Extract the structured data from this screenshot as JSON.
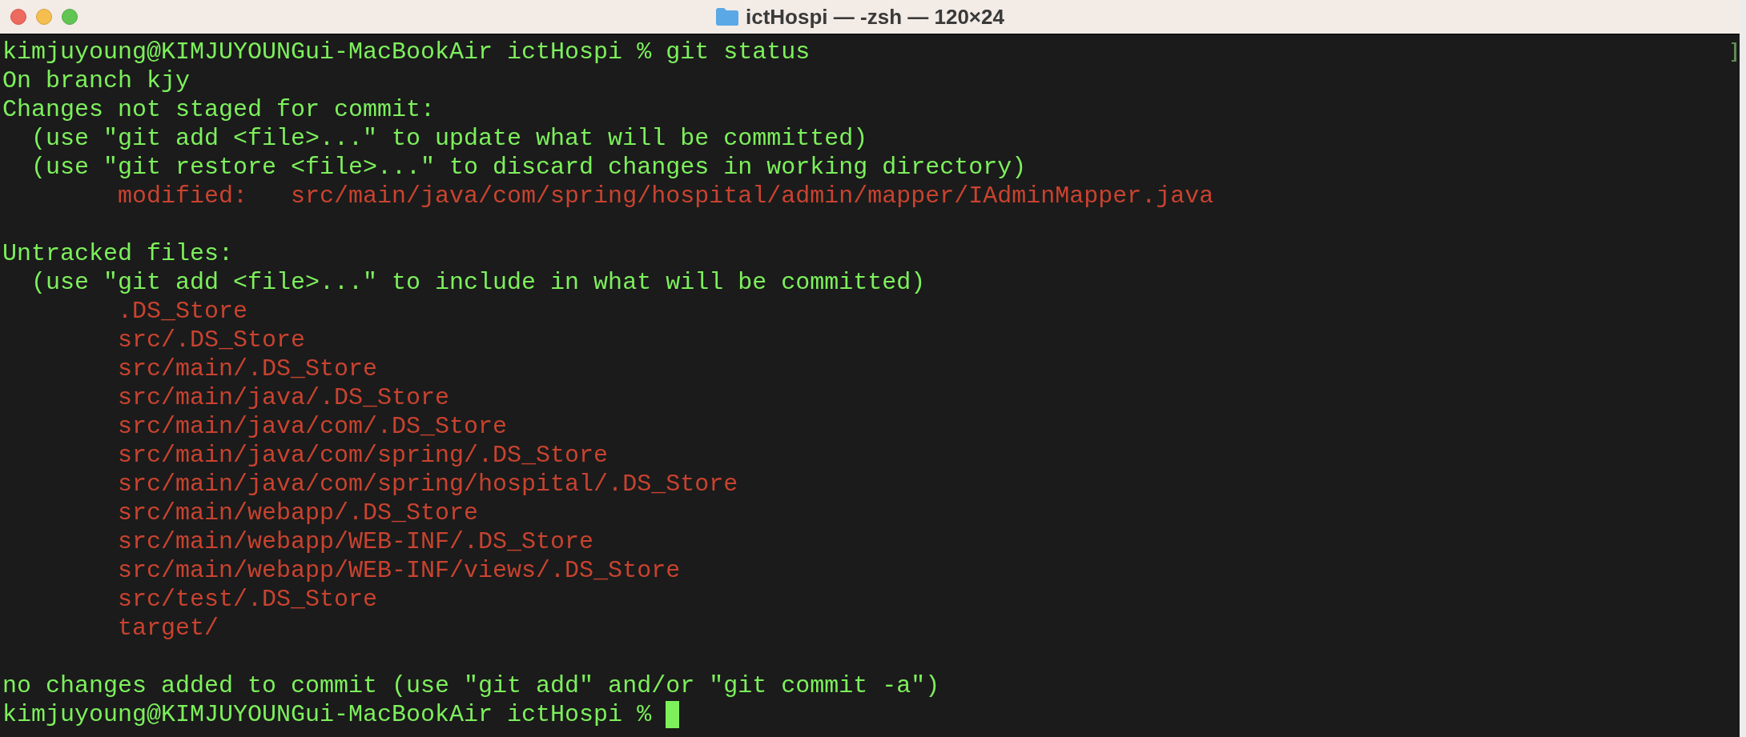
{
  "window": {
    "title": "ictHospi — -zsh — 120×24"
  },
  "lines": [
    {
      "kind": "text",
      "color": "#7df05c",
      "text": "kimjuyoung@KIMJUYOUNGui-MacBookAir ictHospi % git status"
    },
    {
      "kind": "text",
      "color": "#7df05c",
      "text": "On branch kjy"
    },
    {
      "kind": "text",
      "color": "#7df05c",
      "text": "Changes not staged for commit:"
    },
    {
      "kind": "text",
      "color": "#7df05c",
      "text": "  (use \"git add <file>...\" to update what will be committed)"
    },
    {
      "kind": "text",
      "color": "#7df05c",
      "text": "  (use \"git restore <file>...\" to discard changes in working directory)"
    },
    {
      "kind": "text",
      "color": "#c9432f",
      "text": "        modified:   src/main/java/com/spring/hospital/admin/mapper/IAdminMapper.java"
    },
    {
      "kind": "blank"
    },
    {
      "kind": "text",
      "color": "#7df05c",
      "text": "Untracked files:"
    },
    {
      "kind": "text",
      "color": "#7df05c",
      "text": "  (use \"git add <file>...\" to include in what will be committed)"
    },
    {
      "kind": "text",
      "color": "#c9432f",
      "text": "        .DS_Store"
    },
    {
      "kind": "text",
      "color": "#c9432f",
      "text": "        src/.DS_Store"
    },
    {
      "kind": "text",
      "color": "#c9432f",
      "text": "        src/main/.DS_Store"
    },
    {
      "kind": "text",
      "color": "#c9432f",
      "text": "        src/main/java/.DS_Store"
    },
    {
      "kind": "text",
      "color": "#c9432f",
      "text": "        src/main/java/com/.DS_Store"
    },
    {
      "kind": "text",
      "color": "#c9432f",
      "text": "        src/main/java/com/spring/.DS_Store"
    },
    {
      "kind": "text",
      "color": "#c9432f",
      "text": "        src/main/java/com/spring/hospital/.DS_Store"
    },
    {
      "kind": "text",
      "color": "#c9432f",
      "text": "        src/main/webapp/.DS_Store"
    },
    {
      "kind": "text",
      "color": "#c9432f",
      "text": "        src/main/webapp/WEB-INF/.DS_Store"
    },
    {
      "kind": "text",
      "color": "#c9432f",
      "text": "        src/main/webapp/WEB-INF/views/.DS_Store"
    },
    {
      "kind": "text",
      "color": "#c9432f",
      "text": "        src/test/.DS_Store"
    },
    {
      "kind": "text",
      "color": "#c9432f",
      "text": "        target/"
    },
    {
      "kind": "blank"
    },
    {
      "kind": "text",
      "color": "#7df05c",
      "text": "no changes added to commit (use \"git add\" and/or \"git commit -a\")"
    },
    {
      "kind": "prompt",
      "color": "#7df05c",
      "text": "kimjuyoung@KIMJUYOUNGui-MacBookAir ictHospi % "
    }
  ]
}
